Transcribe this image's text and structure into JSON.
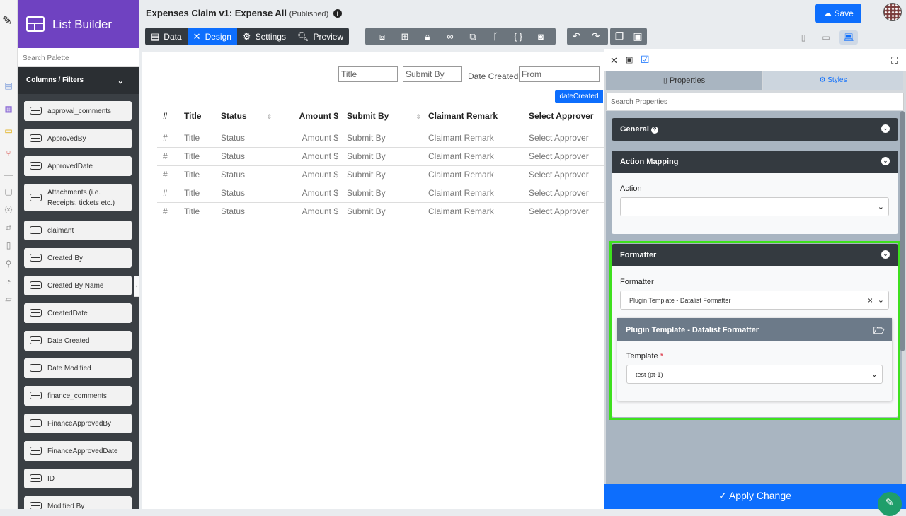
{
  "palette": {
    "title": "List Builder",
    "search_placeholder": "Search Palette",
    "section": "Columns / Filters",
    "items": [
      "approval_comments",
      "ApprovedBy",
      "ApprovedDate",
      "Attachments (i.e. Receipts, tickets etc.)",
      "claimant",
      "Created By",
      "Created By Name",
      "CreatedDate",
      "Date Created",
      "Date Modified",
      "finance_comments",
      "FinanceApprovedBy",
      "FinanceApprovedDate",
      "ID",
      "Modified By"
    ]
  },
  "header": {
    "title": "Expenses Claim v1: Expense All",
    "status": "(Published)",
    "tabs": [
      "Data",
      "Design",
      "Settings",
      "Preview"
    ],
    "save_label": "Save"
  },
  "canvas": {
    "filters": {
      "title": "Title",
      "submit_by": "Submit By",
      "date_created_label": "Date Created",
      "from": "From"
    },
    "date_tag": "dateCreated",
    "columns": [
      "#",
      "Title",
      "Status",
      "Amount $",
      "Submit By",
      "Claimant Remark",
      "Select Approver"
    ],
    "rows": [
      [
        "#",
        "Title",
        "Status",
        "Amount $",
        "Submit By",
        "Claimant Remark",
        "Select Approver"
      ],
      [
        "#",
        "Title",
        "Status",
        "Amount $",
        "Submit By",
        "Claimant Remark",
        "Select Approver"
      ],
      [
        "#",
        "Title",
        "Status",
        "Amount $",
        "Submit By",
        "Claimant Remark",
        "Select Approver"
      ],
      [
        "#",
        "Title",
        "Status",
        "Amount $",
        "Submit By",
        "Claimant Remark",
        "Select Approver"
      ],
      [
        "#",
        "Title",
        "Status",
        "Amount $",
        "Submit By",
        "Claimant Remark",
        "Select Approver"
      ]
    ]
  },
  "properties": {
    "tab_properties": "Properties",
    "tab_styles": "Styles",
    "search_placeholder": "Search Properties",
    "general": "General",
    "action_mapping": "Action Mapping",
    "action_label": "Action",
    "action_value": "",
    "formatter_header": "Formatter",
    "formatter_label": "Formatter",
    "formatter_value": "Plugin Template - Datalist Formatter",
    "plugin_header": "Plugin Template - Datalist Formatter",
    "template_label": "Template",
    "template_required": "*",
    "template_value": "test (pt-1)",
    "apply_label": "Apply Change"
  },
  "colors": {
    "accent": "#0d6efd",
    "brand": "#6f42c1",
    "highlight": "#3ee01e",
    "dark": "#343a40"
  }
}
